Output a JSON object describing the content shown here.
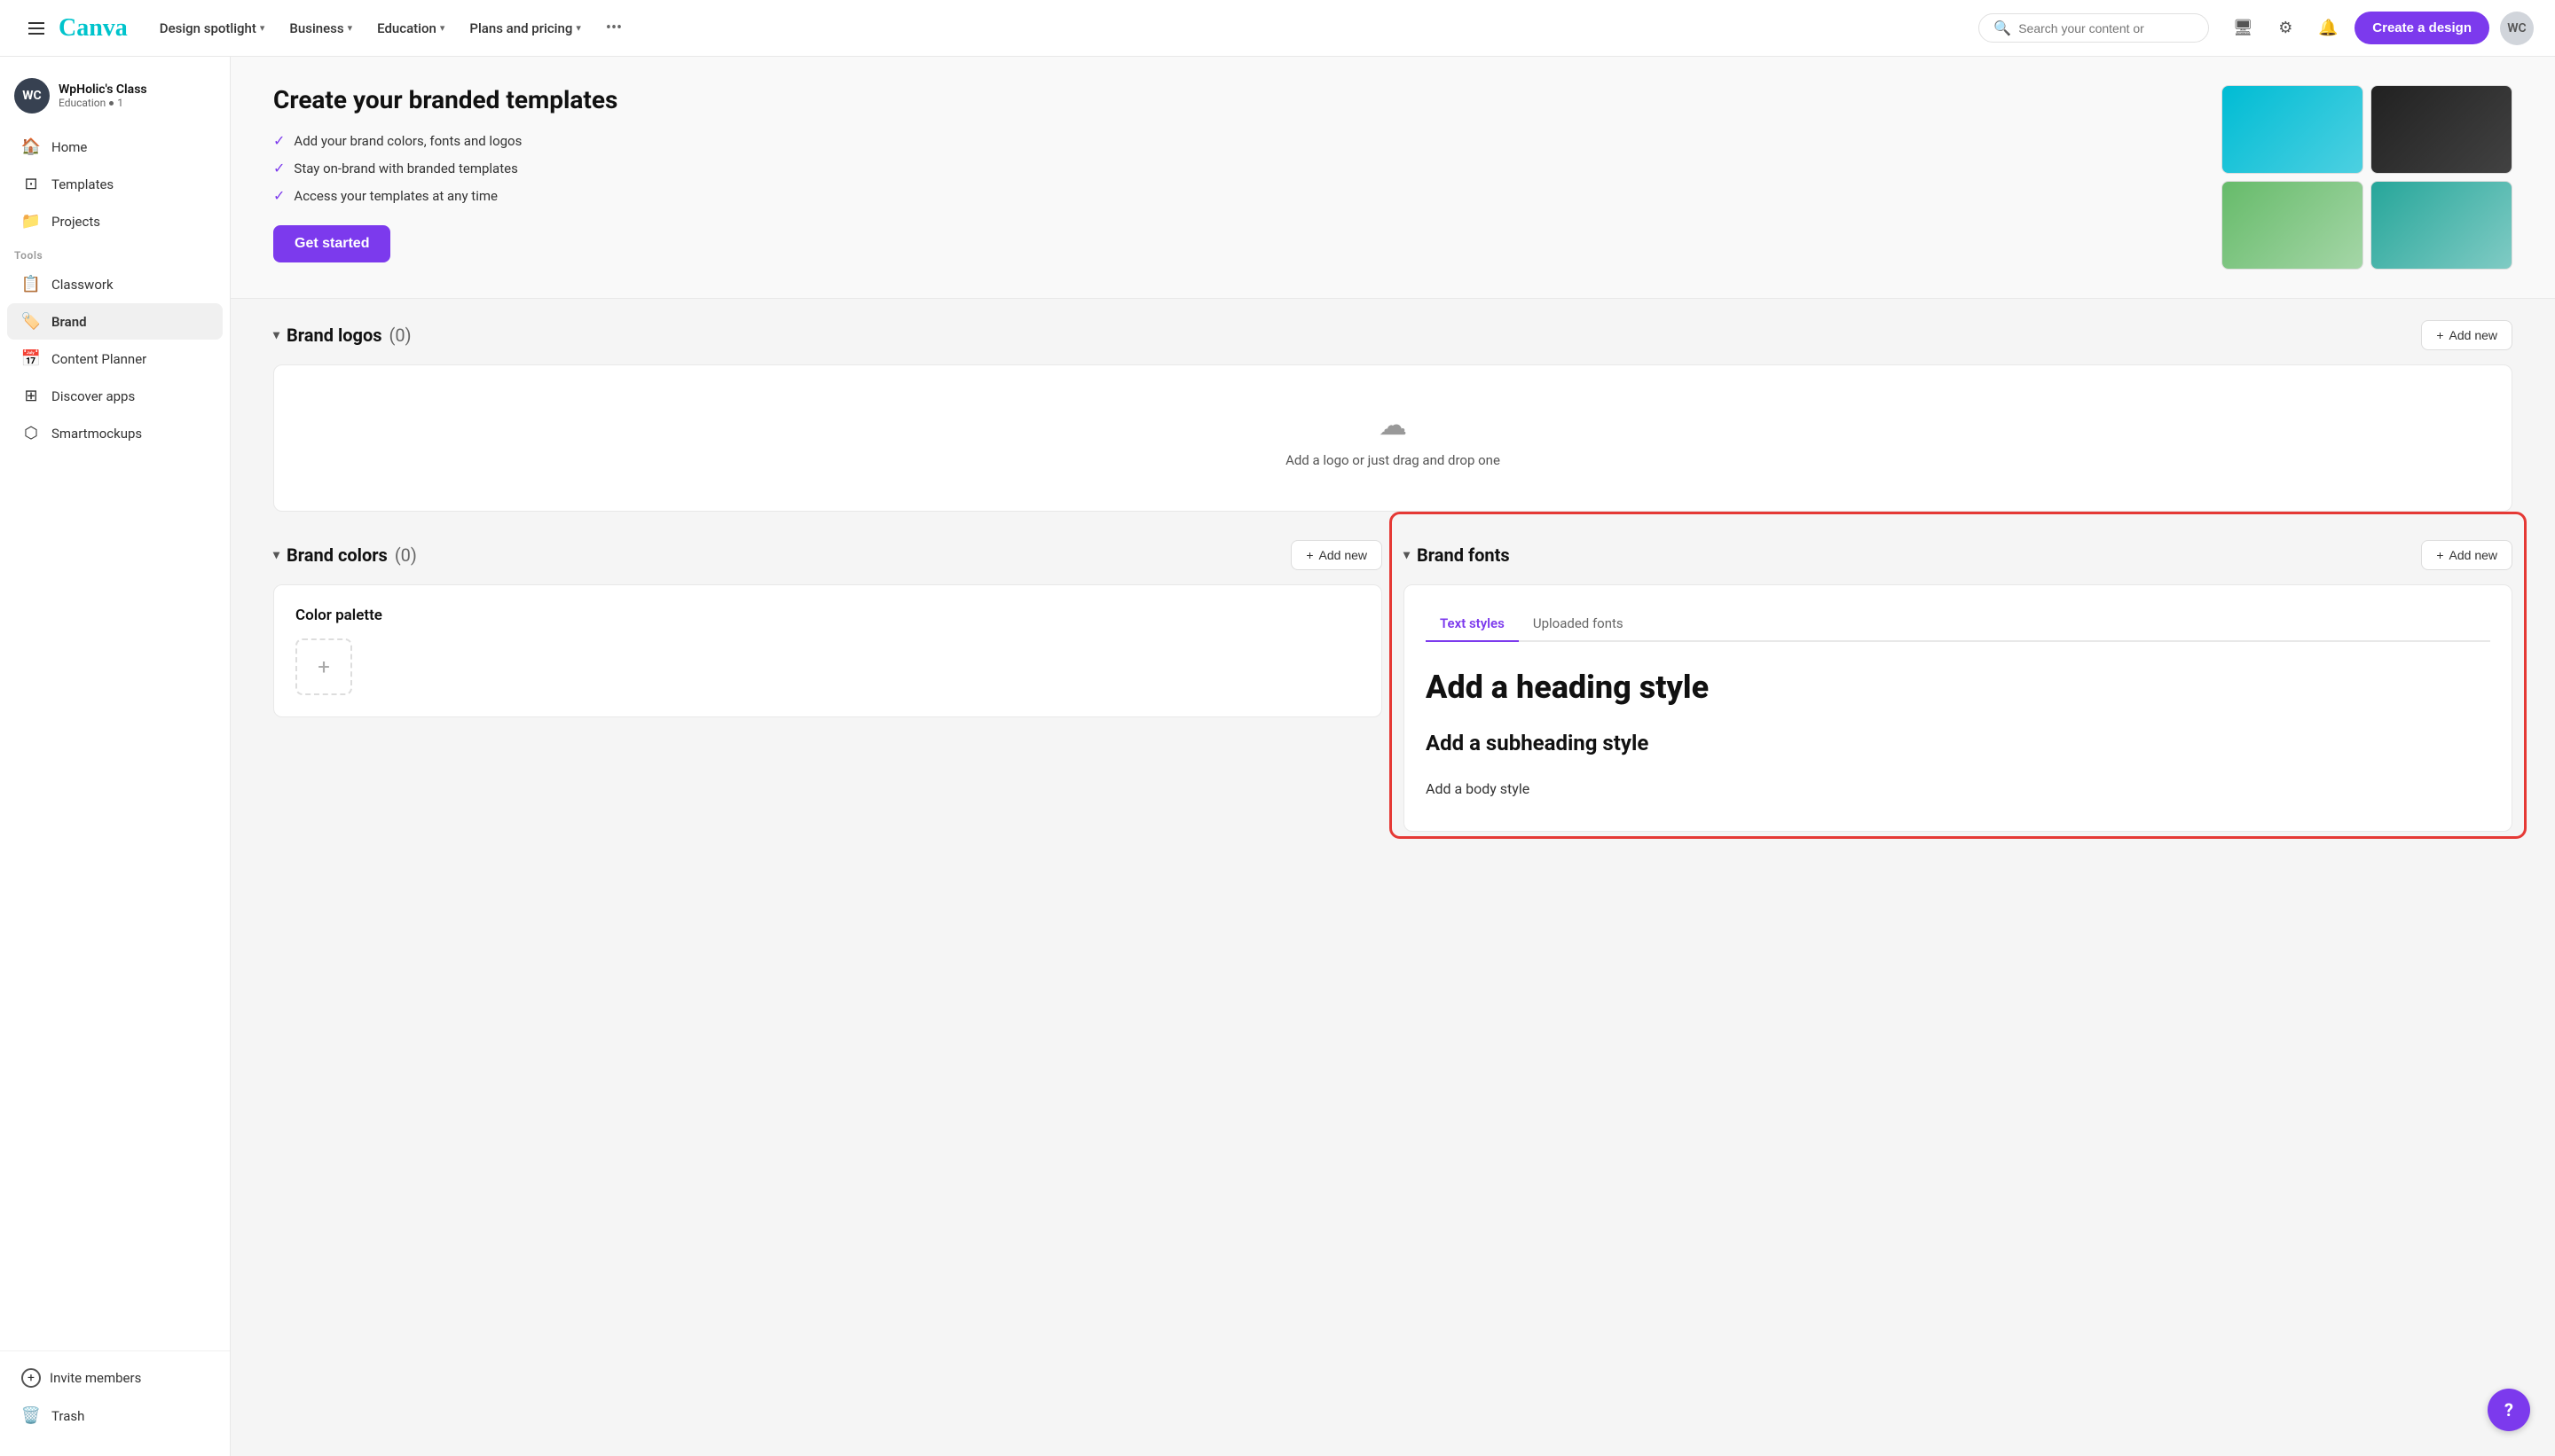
{
  "nav": {
    "logo": "Canva",
    "items": [
      {
        "label": "Design spotlight",
        "has_chevron": true
      },
      {
        "label": "Business",
        "has_chevron": true
      },
      {
        "label": "Education",
        "has_chevron": true
      },
      {
        "label": "Plans and pricing",
        "has_chevron": true
      }
    ],
    "more_icon": "•••",
    "search_placeholder": "Search your content or",
    "create_label": "Create a design"
  },
  "sidebar": {
    "user": {
      "initials": "WC",
      "name": "WpHolic's Class",
      "sub": "Education",
      "dot": "•",
      "count": "1"
    },
    "nav_items": [
      {
        "label": "Home",
        "icon": "🏠"
      },
      {
        "label": "Templates",
        "icon": "⊡"
      },
      {
        "label": "Projects",
        "icon": "📁"
      }
    ],
    "tools_label": "Tools",
    "tool_items": [
      {
        "label": "Classwork",
        "icon": "📋"
      },
      {
        "label": "Brand",
        "icon": "🏷️",
        "active": true
      },
      {
        "label": "Content Planner",
        "icon": "📅"
      },
      {
        "label": "Discover apps",
        "icon": "⊞"
      },
      {
        "label": "Smartmockups",
        "icon": "⬡"
      }
    ],
    "invite_label": "Invite members",
    "trash_label": "Trash",
    "trash_icon": "🗑️"
  },
  "hero": {
    "title": "Create your branded templates",
    "checklist": [
      "Add your brand colors, fonts and logos",
      "Stay on-brand with branded templates",
      "Access your templates at any time"
    ],
    "button_label": "Get started"
  },
  "brand_logos": {
    "title": "Brand logos",
    "count": "(0)",
    "add_new": "Add new",
    "upload_text": "Add a logo or just drag and drop one"
  },
  "brand_colors": {
    "title": "Brand colors",
    "count": "(0)",
    "add_new": "Add new",
    "palette_label": "Color palette",
    "add_color_icon": "+"
  },
  "brand_fonts": {
    "title": "Brand fonts",
    "add_new": "Add new",
    "tabs": [
      {
        "label": "Text styles",
        "active": true
      },
      {
        "label": "Uploaded fonts",
        "active": false
      }
    ],
    "styles": [
      {
        "label": "Add a heading style",
        "size": "heading"
      },
      {
        "label": "Add a subheading style",
        "size": "subheading"
      },
      {
        "label": "Add a body style",
        "size": "body"
      }
    ]
  },
  "help": {
    "icon": "?"
  }
}
